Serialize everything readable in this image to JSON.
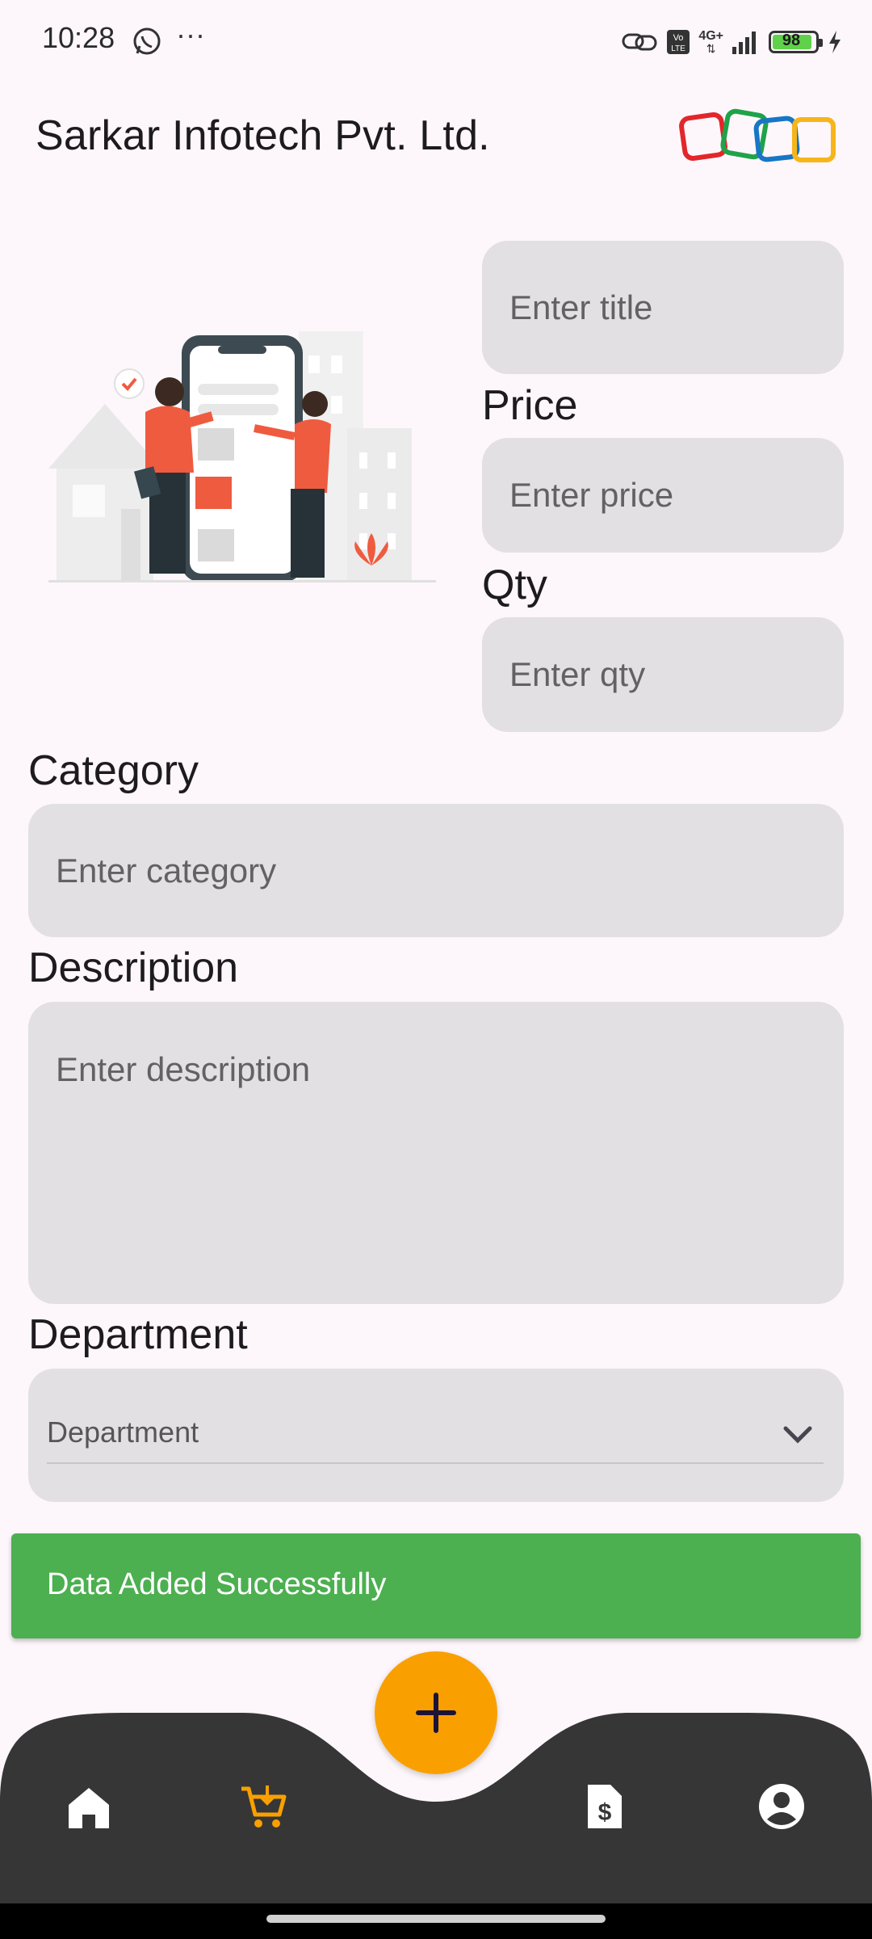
{
  "status_bar": {
    "time": "10:28",
    "battery": "98",
    "network": "4G+"
  },
  "header": {
    "title": "Sarkar Infotech Pvt. Ltd."
  },
  "form": {
    "title_placeholder": "Enter title",
    "price_label": "Price",
    "price_placeholder": "Enter price",
    "qty_label": "Qty",
    "qty_placeholder": "Enter qty",
    "category_label": "Category",
    "category_placeholder": "Enter category",
    "description_label": "Description",
    "description_placeholder": "Enter description",
    "department_label": "Department",
    "department_hint": "Department"
  },
  "snackbar": {
    "message": "Data Added Successfully",
    "color": "#4caf50"
  },
  "bottom_nav": {
    "items": [
      "home-icon",
      "cart-icon",
      "invoice-icon",
      "account-icon"
    ],
    "active": "cart-icon",
    "accent": "#f9a000",
    "bar_color": "#363636"
  }
}
